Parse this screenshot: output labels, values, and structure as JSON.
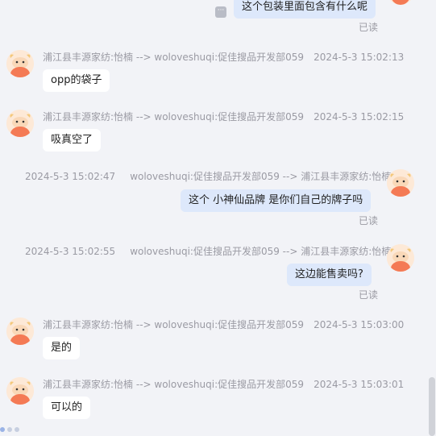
{
  "messages": [
    {
      "dir": "out",
      "text": "这个包装里面包含有什么呢",
      "status": "已读",
      "header": "",
      "time": ""
    },
    {
      "dir": "in",
      "header": "浦江县丰源家纺:怡楠 --> woloveshuqi:促佳搜品开发部059",
      "time": "2024-5-3 15:02:13",
      "text": "opp的袋子"
    },
    {
      "dir": "in",
      "header": "浦江县丰源家纺:怡楠 --> woloveshuqi:促佳搜品开发部059",
      "time": "2024-5-3 15:02:15",
      "text": "吸真空了"
    },
    {
      "dir": "out",
      "time": "2024-5-3 15:02:47",
      "header": "woloveshuqi:促佳搜品开发部059 --> 浦江县丰源家纺:怡楠",
      "text": "这个  小神仙品牌 是你们自己的牌子吗",
      "status": "已读"
    },
    {
      "dir": "out",
      "time": "2024-5-3 15:02:55",
      "header": "woloveshuqi:促佳搜品开发部059 --> 浦江县丰源家纺:怡楠",
      "text": "这边能售卖吗?",
      "status": "已读"
    },
    {
      "dir": "in",
      "header": "浦江县丰源家纺:怡楠 --> woloveshuqi:促佳搜品开发部059",
      "time": "2024-5-3 15:03:00",
      "text": "是的"
    },
    {
      "dir": "in",
      "header": "浦江县丰源家纺:怡楠 --> woloveshuqi:促佳搜品开发部059",
      "time": "2024-5-3 15:03:01",
      "text": "可以的"
    }
  ],
  "icons": {
    "avatar": "cartoon-bull-avatar-icon",
    "more": "more-options-icon"
  },
  "colors": {
    "background": "#f2f3f7",
    "bubble_in": "#ffffff",
    "bubble_out": "#dde8fb",
    "meta": "#9a9aa3"
  }
}
